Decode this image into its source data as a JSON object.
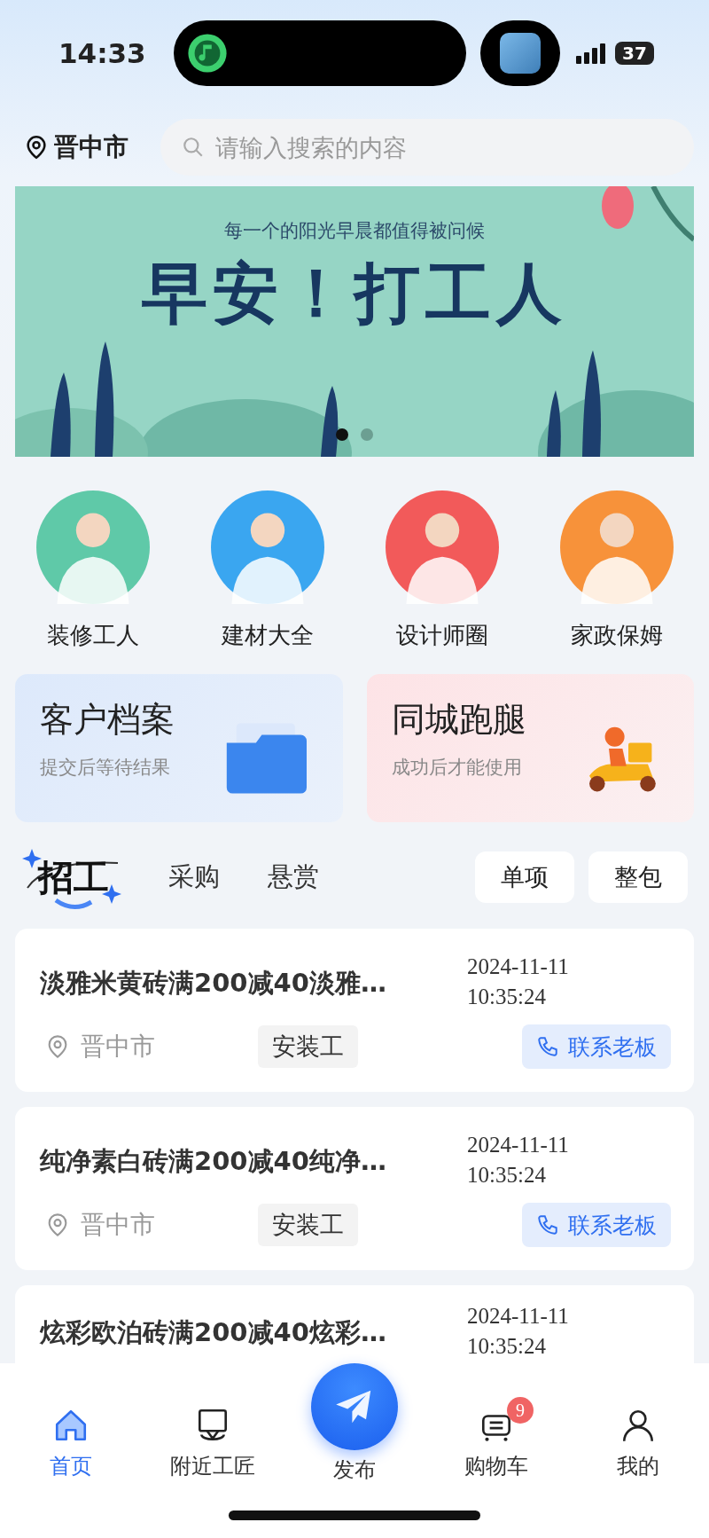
{
  "status_bar": {
    "time": "14:33",
    "battery": "37"
  },
  "location": "晋中市",
  "search": {
    "placeholder": "请输入搜索的内容"
  },
  "banner": {
    "subtitle": "每一个的阳光早晨都值得被问候",
    "headline": "早安！打工人",
    "dots": [
      {
        "selected": true
      },
      {
        "selected": false
      }
    ]
  },
  "categories": [
    {
      "label": "装修工人",
      "color": "#5fc9a8"
    },
    {
      "label": "建材大全",
      "color": "#3aa6f0"
    },
    {
      "label": "设计师圈",
      "color": "#f25a5a"
    },
    {
      "label": "家政保姆",
      "color": "#f7923a"
    }
  ],
  "feature_cards": [
    {
      "kind": "folder",
      "title": "客户档案",
      "subtitle": "提交后等待结果"
    },
    {
      "kind": "scooter",
      "title": "同城跑腿",
      "subtitle": "成功后才能使用"
    }
  ],
  "tabs": [
    {
      "label": "招工",
      "selected": true
    },
    {
      "label": "采购",
      "selected": false
    },
    {
      "label": "悬赏",
      "selected": false
    }
  ],
  "filters": [
    {
      "label": "单项"
    },
    {
      "label": "整包"
    }
  ],
  "jobs": [
    {
      "title": "淡雅米黄砖满200减40淡雅…",
      "date": "2024-11-11",
      "time": "10:35:24",
      "location": "晋中市",
      "tag": "安装工",
      "contact": "联系老板"
    },
    {
      "title": "纯净素白砖满200减40纯净…",
      "date": "2024-11-11",
      "time": "10:35:24",
      "location": "晋中市",
      "tag": "安装工",
      "contact": "联系老板"
    },
    {
      "title": "炫彩欧泊砖满200减40炫彩…",
      "date": "2024-11-11",
      "time": "10:35:24"
    }
  ],
  "nav": [
    {
      "kind": "home",
      "label": "首页",
      "selected": true
    },
    {
      "kind": "nearby",
      "label": "附近工匠",
      "selected": false
    },
    {
      "kind": "publish",
      "label": "发布",
      "selected": false
    },
    {
      "kind": "cart",
      "label": "购物车",
      "selected": false,
      "badge": "9"
    },
    {
      "kind": "profile",
      "label": "我的",
      "selected": false
    }
  ]
}
